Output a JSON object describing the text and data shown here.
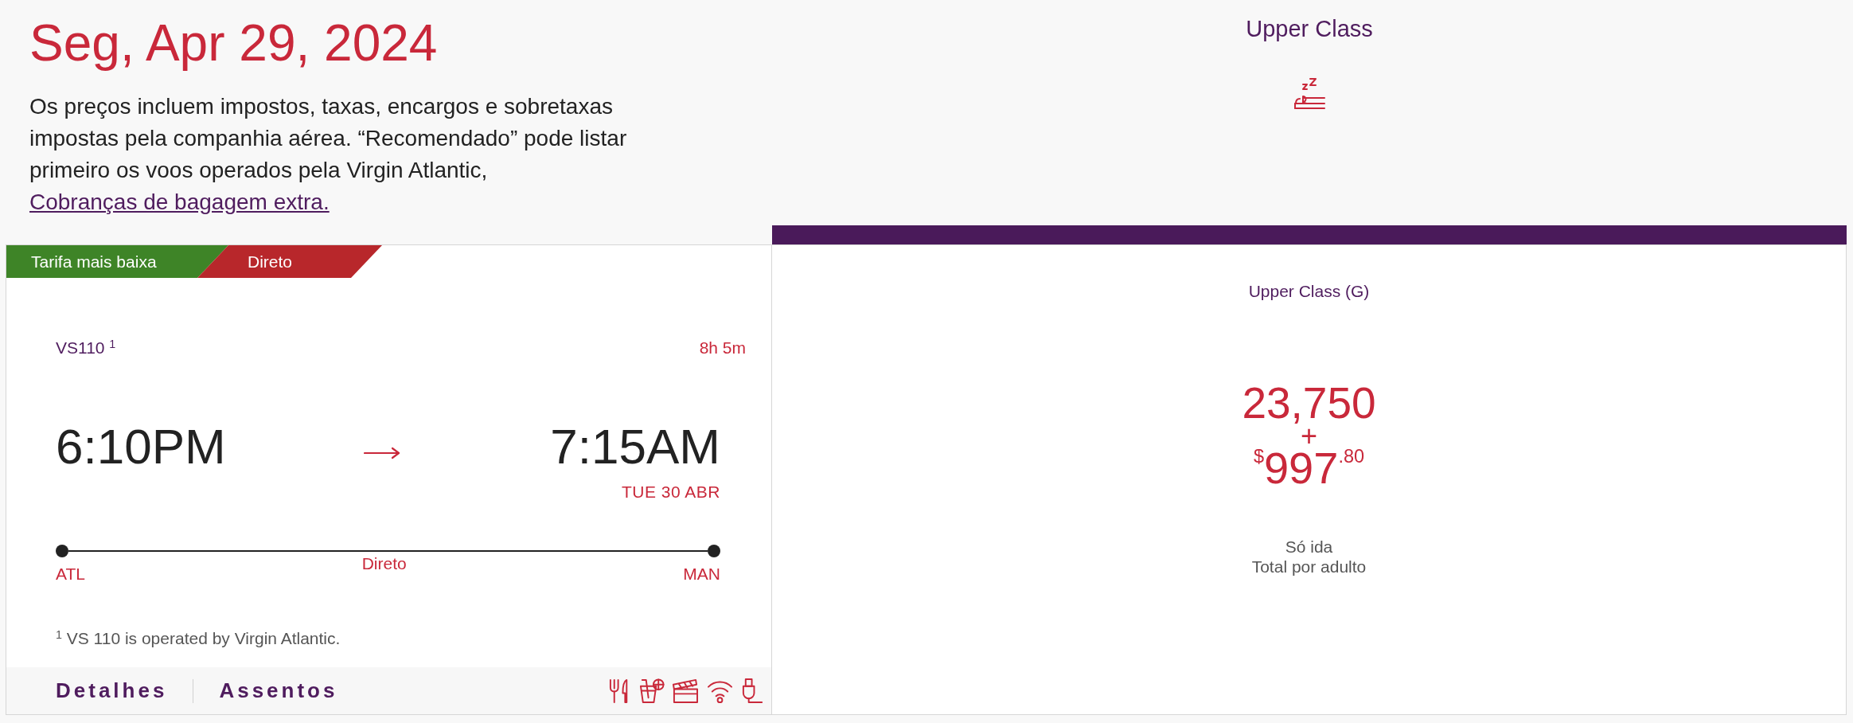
{
  "header": {
    "date": "Seg, Apr 29, 2024",
    "notice": "Os preços incluem impostos, taxas, encargos e sobretaxas impostas pela companhia aérea. “Recomendado” pode listar primeiro os voos operados pela Virgin Atlantic,",
    "link": " Cobranças de bagagem extra."
  },
  "cabin_header": {
    "title": "Upper Class"
  },
  "flight": {
    "badges": [
      {
        "label": "Tarifa mais baixa",
        "color": "#3e8427"
      },
      {
        "label": "Direto",
        "color": "#b8272b"
      }
    ],
    "flight_number": "VS110 $^{1}$",
    "duration": "8h 5m",
    "departure_time": "6:10PM",
    "arrival_time": "7:15AM",
    "arrival_date": "TUE 30 ABR",
    "origin": "ATL",
    "stops": "Direto",
    "destination": "MAN",
    "footnote": "$^{1}$ VS 110 is operated by Virgin Atlantic.",
    "actions": [
      {
        "label": "Detalhes"
      },
      {
        "label": "Assentos"
      }
    ]
  },
  "fare": {
    "cabin": "Upper Class (G)",
    "points": "23,750",
    "plus": "+",
    "cash": "$^{$}$997$^{.80}$",
    "trip_type": "Só ida",
    "price_basis": "Total por adulto"
  }
}
